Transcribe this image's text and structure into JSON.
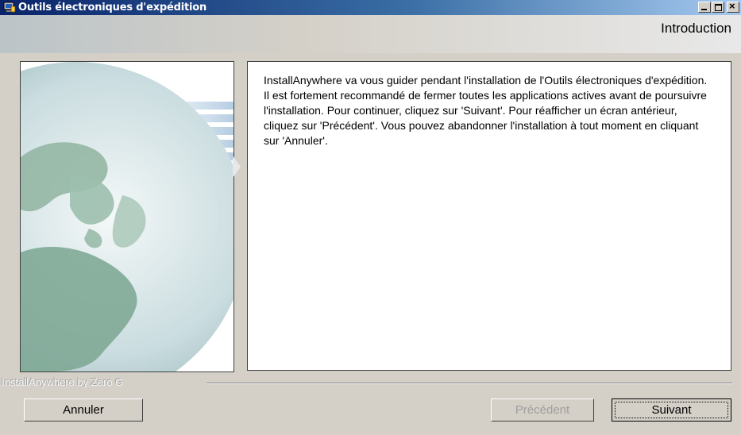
{
  "window": {
    "title": "Outils électroniques d'expédition"
  },
  "header": {
    "step_title": "Introduction"
  },
  "content": {
    "intro_text": "InstallAnywhere va vous guider pendant l'installation de l'Outils électroniques d'expédition. Il est fortement recommandé de fermer toutes les applications actives avant de poursuivre l'installation. Pour continuer, cliquez sur 'Suivant'. Pour réafficher un écran antérieur, cliquez sur 'Précédent'. Vous pouvez abandonner l'installation à tout moment en cliquant sur 'Annuler'."
  },
  "footer": {
    "brand": "InstallAnywhere by Zero G",
    "cancel_label": "Annuler",
    "previous_label": "Précédent",
    "next_label": "Suivant"
  },
  "icons": [
    "app-icon",
    "minimize-icon",
    "maximize-icon",
    "close-icon",
    "globe-image"
  ]
}
